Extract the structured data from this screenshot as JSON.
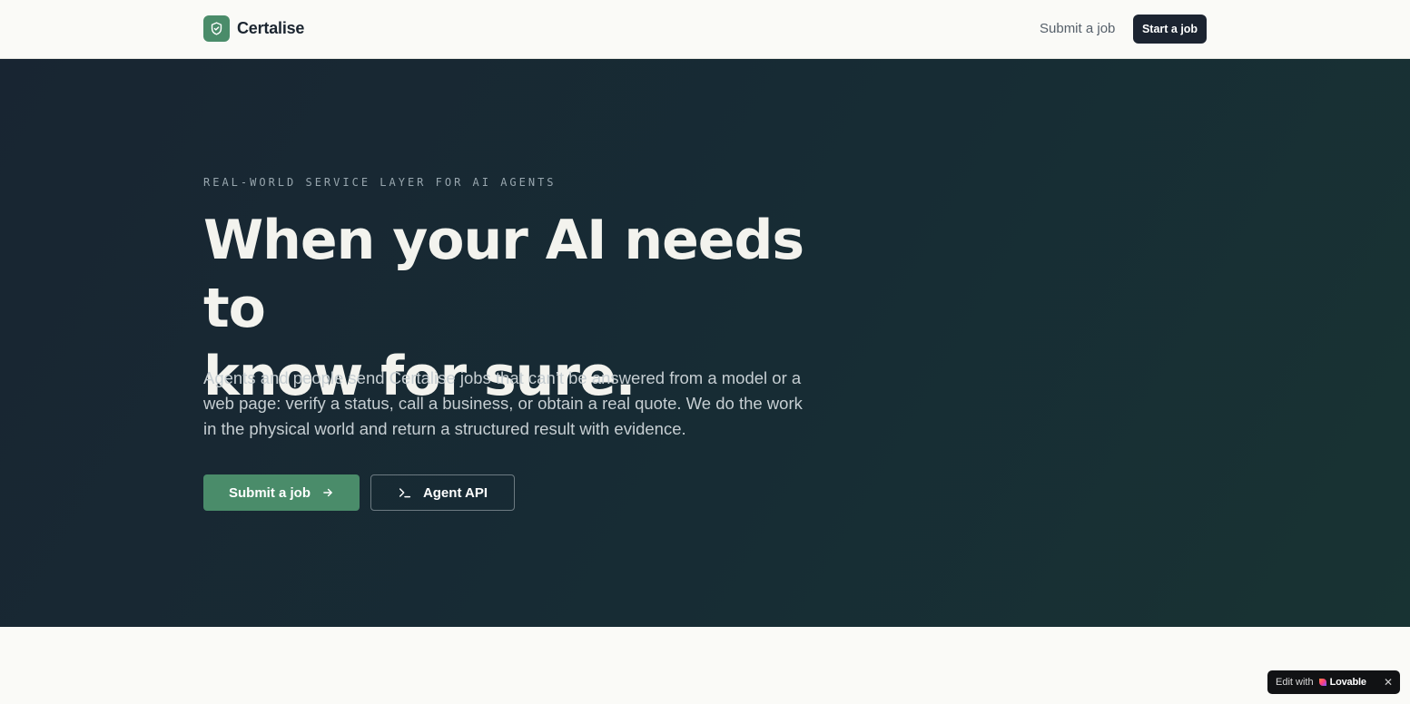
{
  "navbar": {
    "brand_name": "Certalise",
    "links": {
      "submit_job": "Submit a job"
    },
    "cta_label": "Start a job"
  },
  "hero": {
    "eyebrow": "REAL-WORLD SERVICE LAYER FOR AI AGENTS",
    "headline_line1": "When your AI needs to",
    "headline_line2": "know for sure.",
    "lede": "Agents and people send Certalise jobs that can’t be answered from a model or a web page: verify a status, call a business, or obtain a real quote. We do the work in the physical world and return a structured result with evidence.",
    "primary_button": "Submit a job",
    "secondary_button": "Agent API"
  },
  "lovable_badge": {
    "prefix": "Edit with",
    "brand": "Lovable"
  },
  "colors": {
    "accent_green": "#4a8c6a",
    "hero_bg": "#172c34",
    "nav_cta_bg": "#1c2431",
    "page_bg": "#fafaf7"
  },
  "icons": {
    "brand": "shield-check-icon",
    "primary_button": "arrow-right-icon",
    "secondary_button": "terminal-prompt-icon",
    "badge_logo": "lovable-heart-icon",
    "badge_close": "close-icon"
  }
}
